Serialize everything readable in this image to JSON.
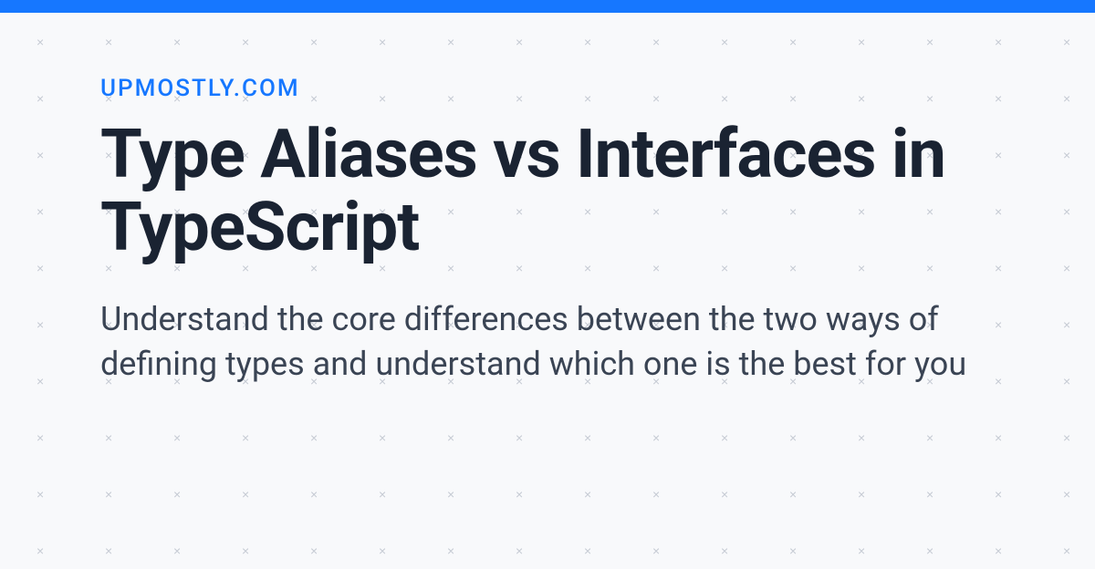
{
  "site_name": "UPMOSTLY.COM",
  "title": "Type Aliases vs Interfaces in TypeScript",
  "description": "Understand the core differences between the two ways of defining types and understand which one is the best for you",
  "colors": {
    "accent": "#1677ff",
    "dark_text": "#1a2332",
    "body_text": "#3a4454",
    "bg": "#f8f9fb",
    "pattern": "#c5cad3"
  }
}
